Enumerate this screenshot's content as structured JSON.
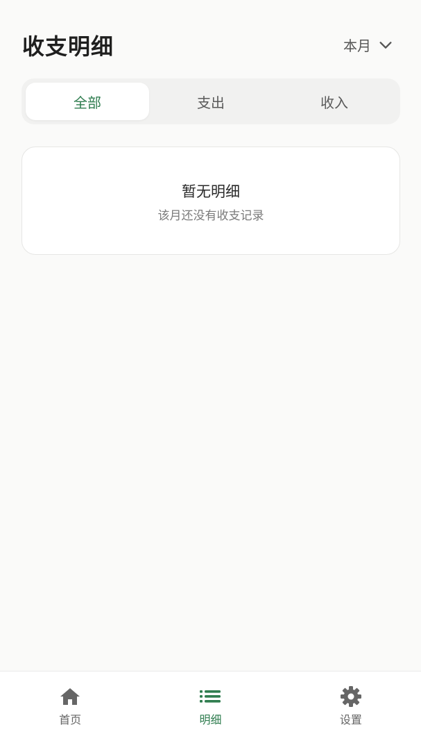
{
  "header": {
    "title": "收支明细",
    "month_label": "本月"
  },
  "filter_tabs": [
    {
      "label": "全部",
      "active": true
    },
    {
      "label": "支出",
      "active": false
    },
    {
      "label": "收入",
      "active": false
    }
  ],
  "empty_state": {
    "title": "暂无明细",
    "subtitle": "该月还没有收支记录"
  },
  "bottom_nav": [
    {
      "label": "首页",
      "icon": "home-icon",
      "active": false
    },
    {
      "label": "明细",
      "icon": "list-icon",
      "active": true
    },
    {
      "label": "设置",
      "icon": "gear-icon",
      "active": false
    }
  ],
  "colors": {
    "accent": "#2f7d4f",
    "inactive_icon": "#666666",
    "background": "#fafaf9"
  }
}
